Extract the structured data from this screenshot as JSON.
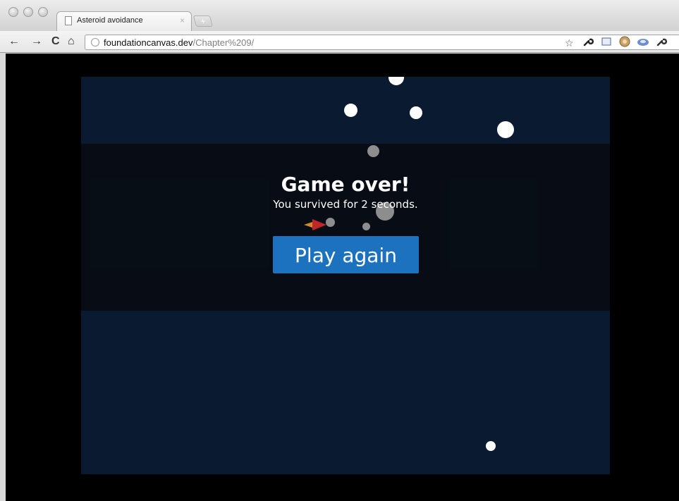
{
  "browser": {
    "tab": {
      "title": "Asteroid avoidance",
      "close_glyph": "×"
    },
    "new_tab_glyph": "+",
    "toolbar": {
      "back_glyph": "←",
      "forward_glyph": "→",
      "reload_glyph": "C",
      "home_glyph": "⌂",
      "star_glyph": "☆",
      "url_host": "foundationcanvas.dev",
      "url_path": "/Chapter%209/"
    }
  },
  "game": {
    "title": "Game over!",
    "subtitle": "You survived for 2 seconds.",
    "play_again_label": "Play again",
    "colors": {
      "background": "#000000",
      "canvas": "#0a1a30",
      "button": "#1d72c0",
      "player": "#c0262a",
      "thrust": "#d08a2a"
    }
  }
}
